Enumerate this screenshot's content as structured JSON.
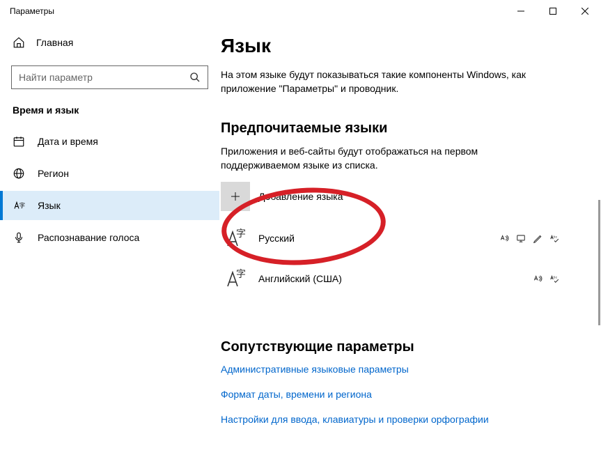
{
  "window": {
    "title": "Параметры"
  },
  "sidebar": {
    "home_label": "Главная",
    "search_placeholder": "Найти параметр",
    "category": "Время и язык",
    "items": [
      {
        "label": "Дата и время"
      },
      {
        "label": "Регион"
      },
      {
        "label": "Язык"
      },
      {
        "label": "Распознавание голоса"
      }
    ]
  },
  "main": {
    "title": "Язык",
    "description": "На этом языке будут показываться такие компоненты Windows, как приложение \"Параметры\" и проводник.",
    "preferred": {
      "heading": "Предпочитаемые языки",
      "description": "Приложения и веб-сайты будут отображаться на первом поддерживаемом языке из списка.",
      "add_label": "Добавление языка",
      "languages": [
        {
          "name": "Русский"
        },
        {
          "name": "Английский (США)"
        }
      ]
    },
    "related": {
      "heading": "Сопутствующие параметры",
      "links": [
        "Административные языковые параметры",
        "Формат даты, времени и региона",
        "Настройки для ввода, клавиатуры и проверки орфографии"
      ]
    }
  }
}
